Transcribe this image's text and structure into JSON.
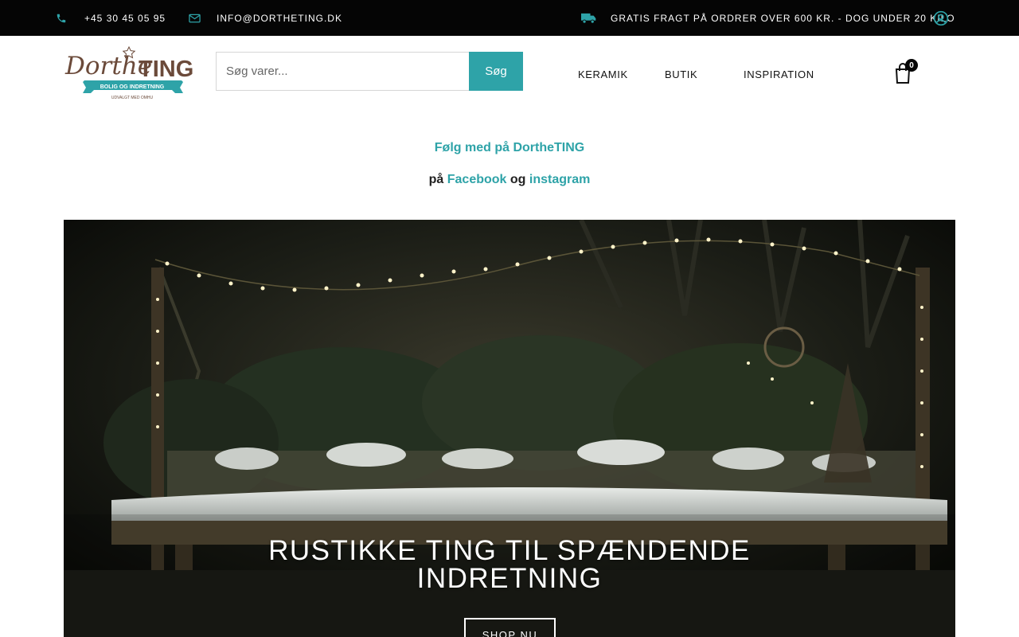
{
  "topbar": {
    "phone": "+45 30 45 05 95",
    "email": "INFO@DORTHETING.DK",
    "shipping": "GRATIS FRAGT PÅ ORDRER OVER 600 KR. - DOG UNDER 20 KILO",
    "icons": [
      "phone-icon",
      "mail-icon",
      "truck-icon",
      "user-icon"
    ]
  },
  "header": {
    "logo": {
      "brand_left": "Dorthe",
      "brand_right": "TING",
      "ribbon": "BOLIG OG INDRETNING",
      "tagline": "UDVALGT MED OMHU"
    },
    "search": {
      "placeholder": "Søg varer...",
      "button": "Søg"
    },
    "nav": [
      "KERAMIK",
      "BUTIK",
      "INSPIRATION"
    ],
    "cart_count": "0"
  },
  "follow": {
    "title": "Følg med på DortheTING",
    "prefix": "på",
    "facebook": "Facebook",
    "connector": "og",
    "instagram": "instagram"
  },
  "hero": {
    "title_line1": "RUSTIKKE TING TIL SPÆNDENDE",
    "title_line2": "INDRETNING",
    "button": "SHOP NU"
  },
  "colors": {
    "accent": "#2ea3a8",
    "topbar": "#050505",
    "logo_brown": "#6b4a3a"
  }
}
